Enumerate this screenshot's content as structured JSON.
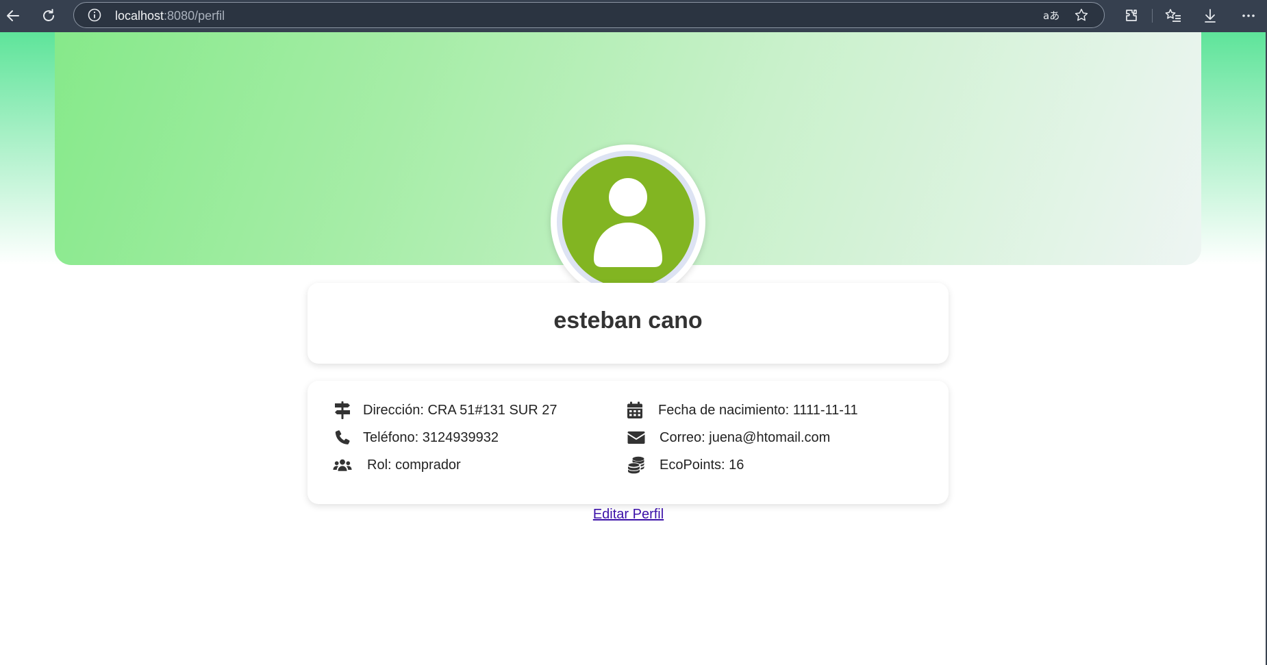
{
  "browser": {
    "url_host": "localhost",
    "url_rest": ":8080/perfil"
  },
  "profile": {
    "name": "esteban cano",
    "avatar_color": "#82b522",
    "info": [
      {
        "icon": "signpost-icon",
        "text": "Dirección: CRA 51#131 SUR 27"
      },
      {
        "icon": "calendar-icon",
        "text": "Fecha de nacimiento: 1111-11-11"
      },
      {
        "icon": "phone-icon",
        "text": "Teléfono: 3124939932"
      },
      {
        "icon": "envelope-icon",
        "text": "Correo: juena@htomail.com"
      },
      {
        "icon": "users-icon",
        "text": "Rol: comprador"
      },
      {
        "icon": "coins-icon",
        "text": "EcoPoints: 16"
      }
    ],
    "edit_link_label": "Editar Perfil"
  },
  "colors": {
    "chrome": "#36404f",
    "link": "#3b10a8"
  }
}
